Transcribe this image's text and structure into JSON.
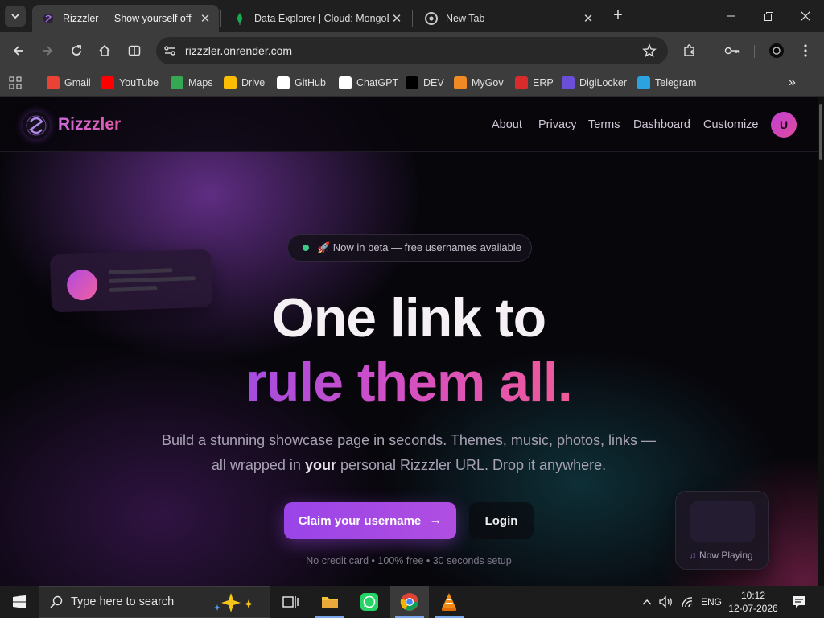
{
  "browser": {
    "tabs": [
      {
        "title": "Rizzzler — Show yourself off",
        "active": true,
        "favicon": "rizzzler-favicon"
      },
      {
        "title": "Data Explorer | Cloud: MongoDB",
        "active": false,
        "favicon": "mongodb-leaf-icon"
      },
      {
        "title": "New Tab",
        "active": false,
        "favicon": "chrome-icon"
      }
    ],
    "new_tab_label": "+",
    "url": "rizzzler.onrender.com",
    "bookmarks": [
      {
        "label": "Gmail",
        "icon": "gmail-icon",
        "color": "#ea4335"
      },
      {
        "label": "YouTube",
        "icon": "youtube-icon",
        "color": "#ff0000"
      },
      {
        "label": "Maps",
        "icon": "maps-icon",
        "color": "#34a853"
      },
      {
        "label": "Drive",
        "icon": "drive-icon",
        "color": "#fbbc04"
      },
      {
        "label": "GitHub",
        "icon": "github-icon",
        "color": "#ffffff"
      },
      {
        "label": "ChatGPT",
        "icon": "chatgpt-icon",
        "color": "#ffffff"
      },
      {
        "label": "DEV",
        "icon": "dev-icon",
        "color": "#000000"
      },
      {
        "label": "MyGov",
        "icon": "mygov-icon",
        "color": "#f08a24"
      },
      {
        "label": "ERP",
        "icon": "erp-icon",
        "color": "#d92b2b"
      },
      {
        "label": "DigiLocker",
        "icon": "digilocker-icon",
        "color": "#6b4fd8"
      },
      {
        "label": "Telegram",
        "icon": "telegram-icon",
        "color": "#2aa3e0"
      }
    ],
    "bookmarks_overflow": "»"
  },
  "site": {
    "brand": "Rizzzler",
    "nav": [
      "About",
      "Privacy",
      "Terms",
      "Dashboard",
      "Customize"
    ],
    "avatar_initial": "U",
    "beta_badge": "🚀 Now in beta — free usernames available",
    "headline_line1": "One link to",
    "headline_line2": "rule them all.",
    "subtitle_line1": "Build a stunning showcase page in seconds. Themes, music, photos, links —",
    "subtitle_line2_pre": "all wrapped in ",
    "subtitle_line2_bold": "your",
    "subtitle_line2_post": " personal Rizzzler URL. Drop it anywhere.",
    "cta_primary": "Claim your username",
    "cta_secondary": "Login",
    "fine_print": "No credit card • 100% free • 30 seconds setup",
    "now_playing": "Now Playing",
    "accent_purple": "#9a44e8",
    "accent_pink": "#f05a98"
  },
  "taskbar": {
    "search_placeholder": "Type here to search",
    "language": "ENG",
    "time": "10:12",
    "date": "12-07-2026"
  }
}
